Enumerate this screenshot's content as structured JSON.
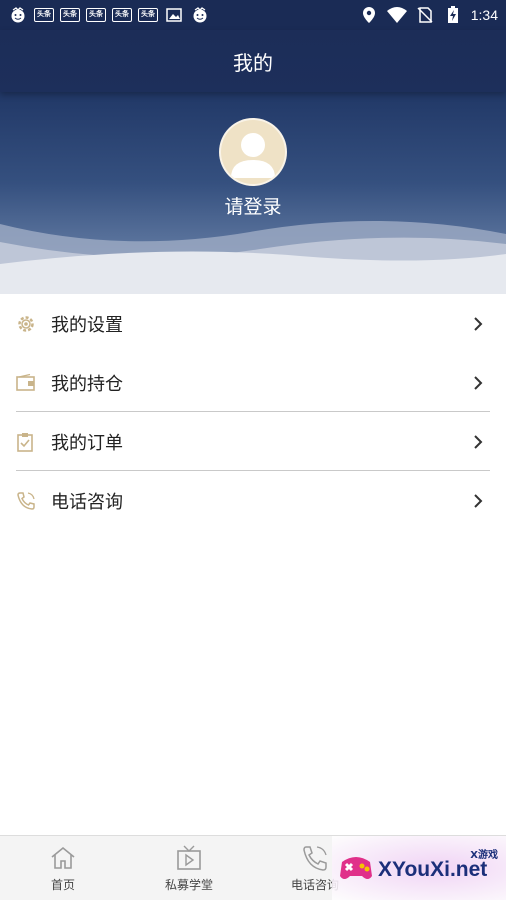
{
  "status_bar": {
    "time": "1:34",
    "news_badge": "头条",
    "icons": [
      "emoji-icon",
      "news-icon",
      "news-icon",
      "news-icon",
      "news-icon",
      "news-icon",
      "image-icon",
      "emoji-icon",
      "location-icon",
      "wifi-icon",
      "no-sim-icon",
      "battery-charging-icon"
    ]
  },
  "header": {
    "title": "我的"
  },
  "profile": {
    "login_label": "请登录",
    "avatar_icon": "user-avatar-icon"
  },
  "menu": {
    "items": [
      {
        "label": "我的设置",
        "icon": "gear-icon"
      },
      {
        "label": "我的持仓",
        "icon": "wallet-icon"
      },
      {
        "label": "我的订单",
        "icon": "clipboard-icon"
      },
      {
        "label": "电话咨询",
        "icon": "phone-icon"
      }
    ]
  },
  "bottom_nav": {
    "items": [
      {
        "label": "首页",
        "icon": "home-icon"
      },
      {
        "label": "私募学堂",
        "icon": "tv-play-icon"
      },
      {
        "label": "电话咨询",
        "icon": "phone-icon"
      }
    ]
  },
  "watermark": {
    "text": "XYouXi.net",
    "sub": "X游戏"
  },
  "colors": {
    "header_bg": "#1d2f5b",
    "accent_icon": "#c9b48a"
  }
}
